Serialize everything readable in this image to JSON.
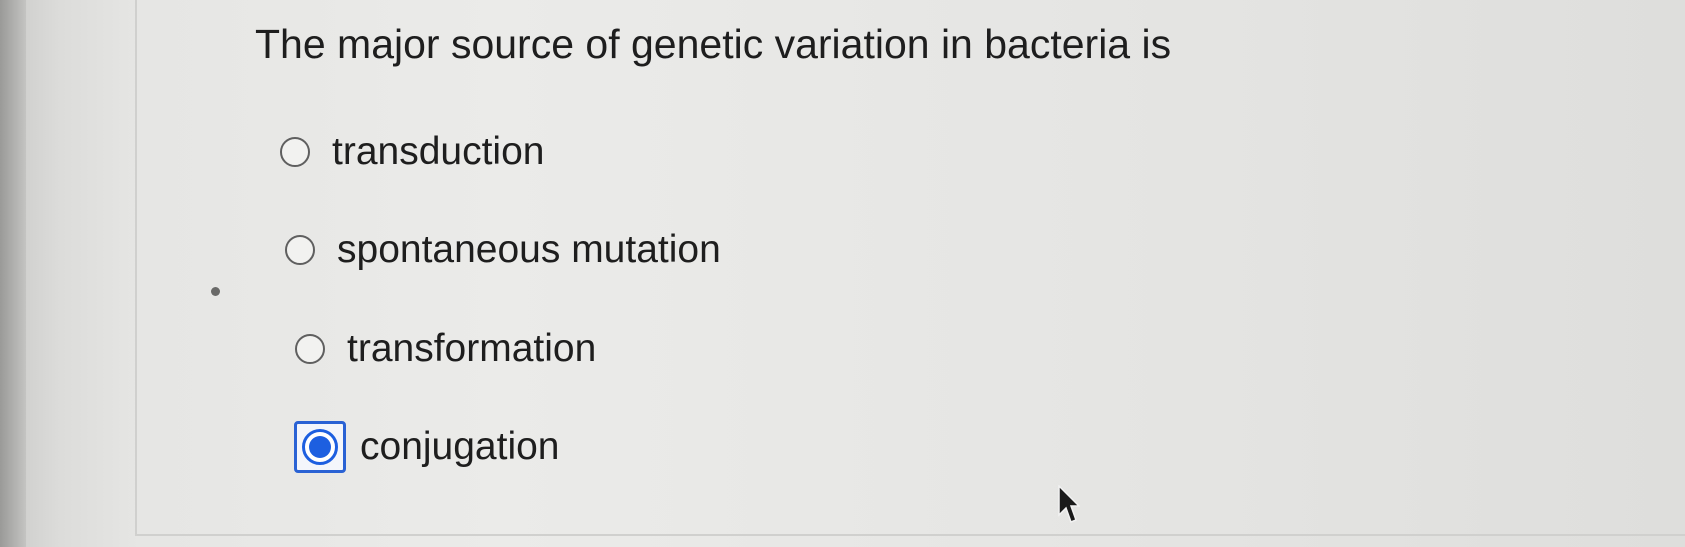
{
  "question": {
    "text": "The major source of genetic variation in bacteria is"
  },
  "options": [
    {
      "label": "transduction",
      "selected": false
    },
    {
      "label": "spontaneous mutation",
      "selected": false
    },
    {
      "label": "transformation",
      "selected": false
    },
    {
      "label": "conjugation",
      "selected": true
    }
  ],
  "colors": {
    "selection_accent": "#1d5fe0",
    "text": "#1e1e1e",
    "background": "#e8e8e6"
  },
  "icons": {
    "unselected": "radio-unselected-icon",
    "selected": "radio-selected-icon",
    "pointer": "mouse-cursor-icon"
  }
}
